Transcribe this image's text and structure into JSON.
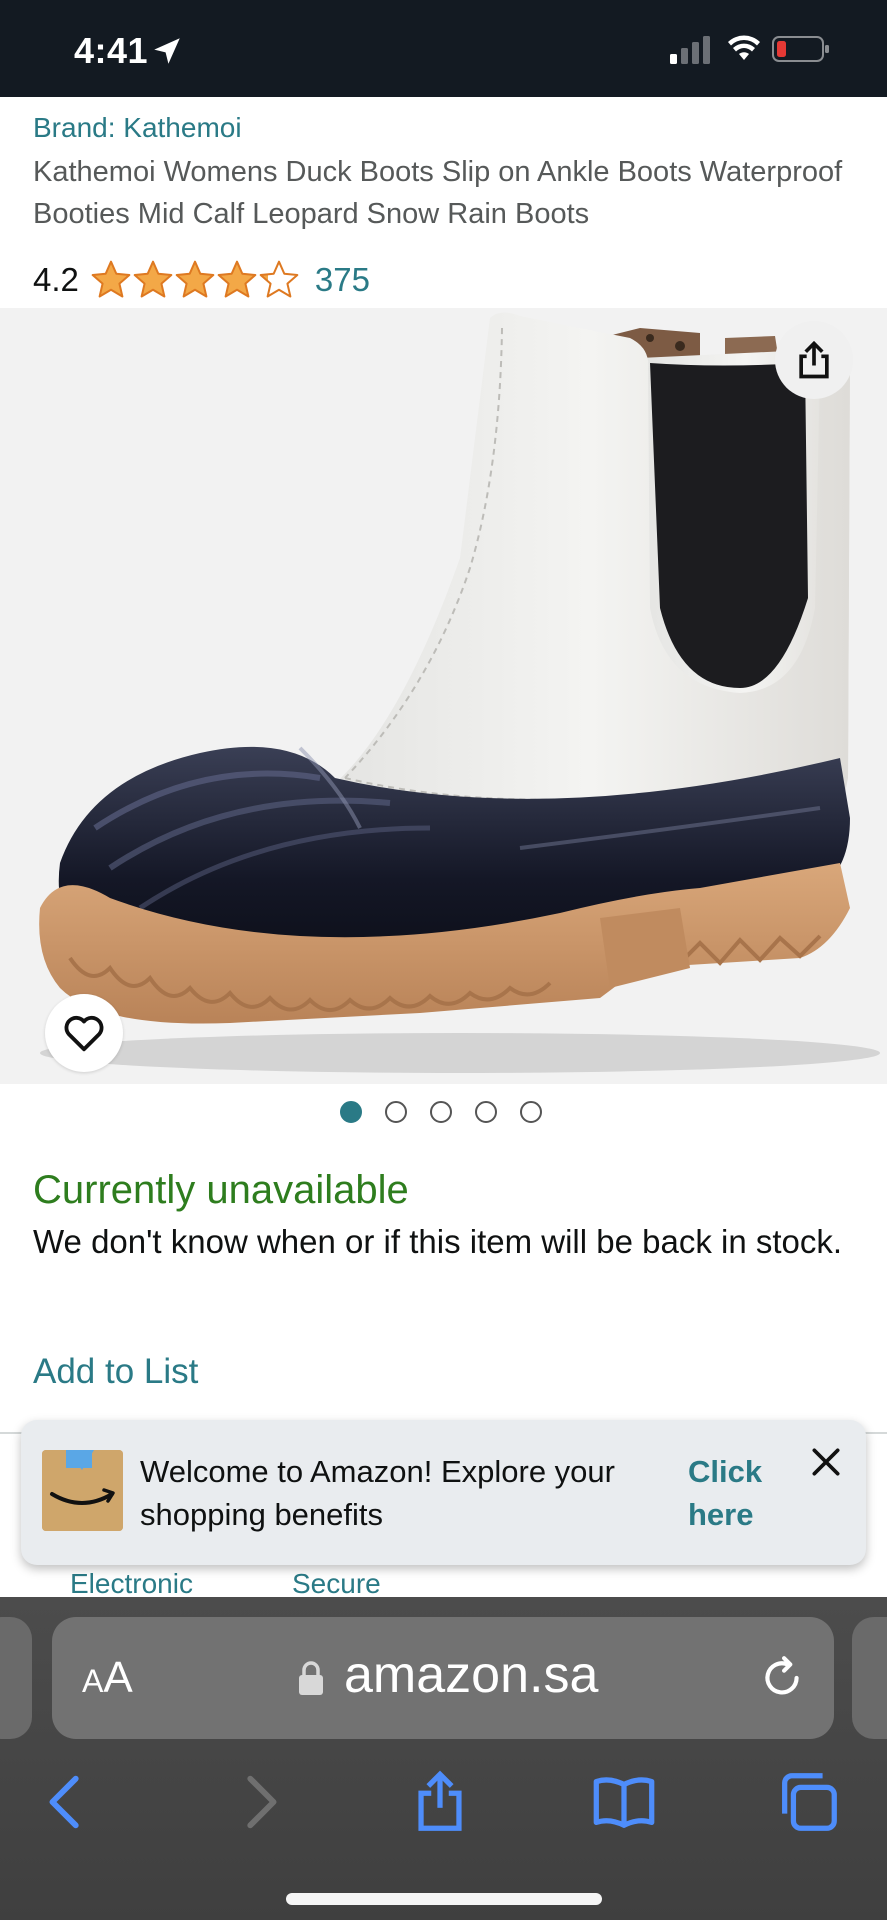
{
  "status_bar": {
    "time": "4:41"
  },
  "product": {
    "brand": "Brand: Kathemoi",
    "title": "Kathemoi Womens Duck Boots Slip on Ankle Boots Waterproof Booties Mid Calf Leopard Snow Rain Boots",
    "rating_value": "4.2",
    "rating_stars": 4.2,
    "rating_count": "375"
  },
  "gallery": {
    "image_count": 5,
    "active_index": 0,
    "share_icon": "share-icon",
    "wishlist_icon": "heart-icon"
  },
  "availability": {
    "status": "Currently unavailable",
    "message": "We don't know when or if this item will be back in stock.",
    "add_to_list": "Add to List"
  },
  "peek": {
    "left": "Electronic",
    "right": "Secure"
  },
  "toast": {
    "message": "Welcome to Amazon! Explore your shopping benefits",
    "cta": "Click here"
  },
  "browser": {
    "text_size_big": "A",
    "text_size_small": "A",
    "url": "amazon.sa"
  },
  "colors": {
    "link": "#2a7a86",
    "available_green": "#2e7d1e",
    "star": "#f3a847",
    "ios_blue": "#4e8dfb"
  }
}
